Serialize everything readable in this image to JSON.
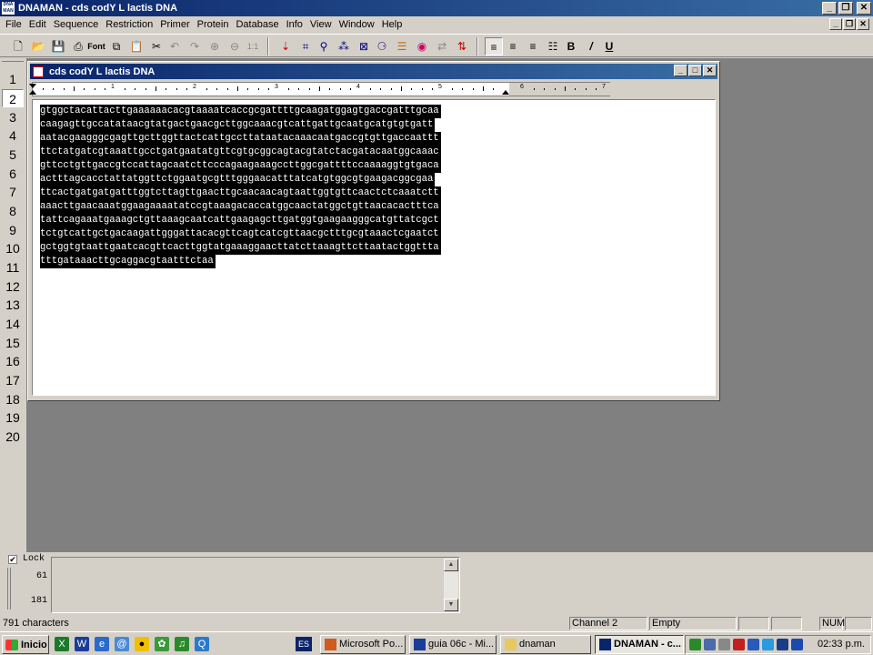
{
  "window": {
    "title": "DNAMAN - cds codY L lactis DNA",
    "icon_text": "DNA MAN"
  },
  "menu": [
    "File",
    "Edit",
    "Sequence",
    "Restriction",
    "Primer",
    "Protein",
    "Database",
    "Info",
    "View",
    "Window",
    "Help"
  ],
  "toolbar": {
    "font_label": "Font"
  },
  "channels": [
    "1",
    "2",
    "3",
    "4",
    "5",
    "6",
    "7",
    "8",
    "9",
    "10",
    "11",
    "12",
    "13",
    "14",
    "15",
    "16",
    "17",
    "18",
    "19",
    "20"
  ],
  "active_channel": "2",
  "document": {
    "title": "cds codY L lactis DNA",
    "ruler_labels": [
      "1",
      "2",
      "3",
      "4",
      "5",
      "6",
      "7"
    ],
    "sequence_lines": [
      "gtggctacattacttgaaaaaacacgtaaaatcaccgcgattttgcaagatggagtgaccgatttgcaa",
      "caagagttgccatataacgtatgactgaacgcttggcaaacgtcattgattgcaatgcatgtgtgatt",
      "aatacgaagggcgagttgcttggttactcattgccttataatacaaacaatgaccgtgttgaccaattt",
      "ttctatgatcgtaaattgcctgatgaatatgttcgtgcggcagtacgtatctacgatacaatggcaaac",
      "gttcctgttgaccgtccattagcaatcttcccagaagaaagccttggcgattttccaaaaggtgtgaca",
      "actttagcacctattatggttctggaatgcgtttgggaacatttatcatgtggcgtgaagacggcgaa",
      "ttcactgatgatgatttggtcttagttgaacttgcaacaacagtaattggtgttcaactctcaaatctt",
      "aaacttgaacaaatggaagaaaatatccgtaaagacaccatggcaactatggctgttaacacactttca",
      "tattcagaaatgaaagctgttaaagcaatcattgaagagcttgatggtgaagaagggcatgttatcgct",
      "tctgtcattgctgacaagattgggattacacgttcagtcatcgttaacgctttgcgtaaactcgaatct",
      "gctggtgtaattgaatcacgttcacttggtatgaaaggaacttatcttaaagttcttaatactggttta",
      "tttgataaacttgcaggacgtaatttctaa"
    ]
  },
  "lock_pane": {
    "lock_label": "Lock",
    "lock_checked": true,
    "range_start": "61",
    "range_end": "181"
  },
  "statusbar": {
    "chars": "791 characters",
    "channel": "Channel 2",
    "state": "Empty",
    "num": "NUM"
  },
  "taskbar": {
    "start_label": "Inicio",
    "language": "ES",
    "tasks": [
      {
        "label": "Microsoft Po..."
      },
      {
        "label": "guia 06c - Mi..."
      },
      {
        "label": "dnaman"
      },
      {
        "label": "DNAMAN - c..."
      }
    ],
    "clock": "02:33 p.m."
  }
}
